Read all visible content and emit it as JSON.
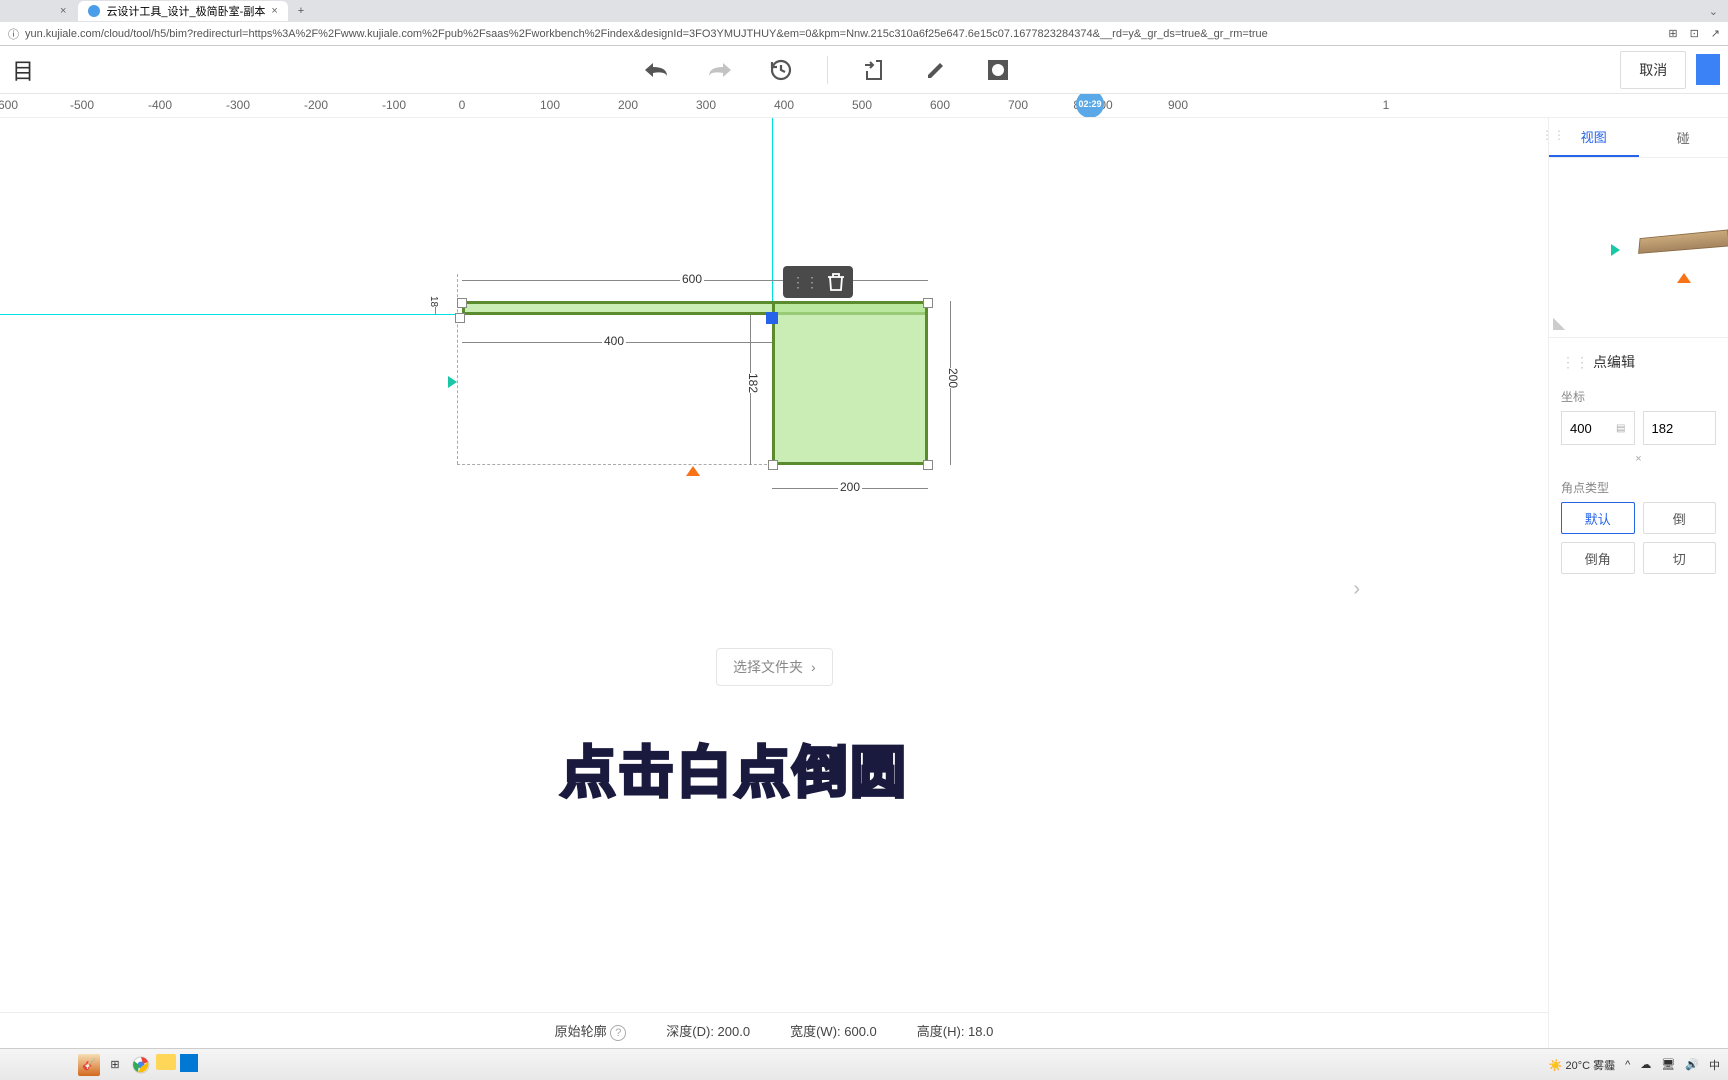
{
  "browser": {
    "tab1_close": "×",
    "tab2_title": "云设计工具_设计_极简卧室-副本",
    "tab2_close": "×",
    "new_tab": "+",
    "url": "yun.kujiale.com/cloud/tool/h5/bim?redirecturl=https%3A%2F%2Fwww.kujiale.com%2Fpub%2Fsaas%2Fworkbench%2Findex&designId=3FO3YMUJTHUY&em=0&kpm=Nnw.215c310a6f25e647.6e15c07.1677823284374&__rd=y&_gr_ds=true&_gr_rm=true"
  },
  "toolbar": {
    "left_char": "目",
    "cancel": "取消"
  },
  "ruler": {
    "marks": [
      "600",
      "-500",
      "-400",
      "-300",
      "-200",
      "-100",
      "0",
      "100",
      "200",
      "300",
      "400",
      "500",
      "600",
      "700",
      "80",
      "00",
      "900",
      "1"
    ]
  },
  "canvas": {
    "dim_600": "600",
    "dim_400": "400",
    "dim_200_right": "200",
    "dim_200_bottom": "200",
    "dim_182": "182",
    "dim_18": "18",
    "folder_btn": "选择文件夹",
    "caption": "点击白点倒圆",
    "time_badge": "02:29"
  },
  "bottom": {
    "original": "原始轮廓",
    "depth": "深度(D): 200.0",
    "width": "宽度(W): 600.0",
    "height": "高度(H): 18.0"
  },
  "panel": {
    "tab_view": "视图",
    "tab_other": "碰",
    "section_title": "点编辑",
    "coord_label": "坐标",
    "coord_x": "400",
    "coord_y": "182",
    "close_x": "×",
    "corner_type_label": "角点类型",
    "btn_default": "默认",
    "btn_other1": "倒",
    "btn_chamfer": "倒角",
    "btn_other2": "切"
  },
  "taskbar": {
    "temp": "20°C 雾霾",
    "ime": "中"
  }
}
